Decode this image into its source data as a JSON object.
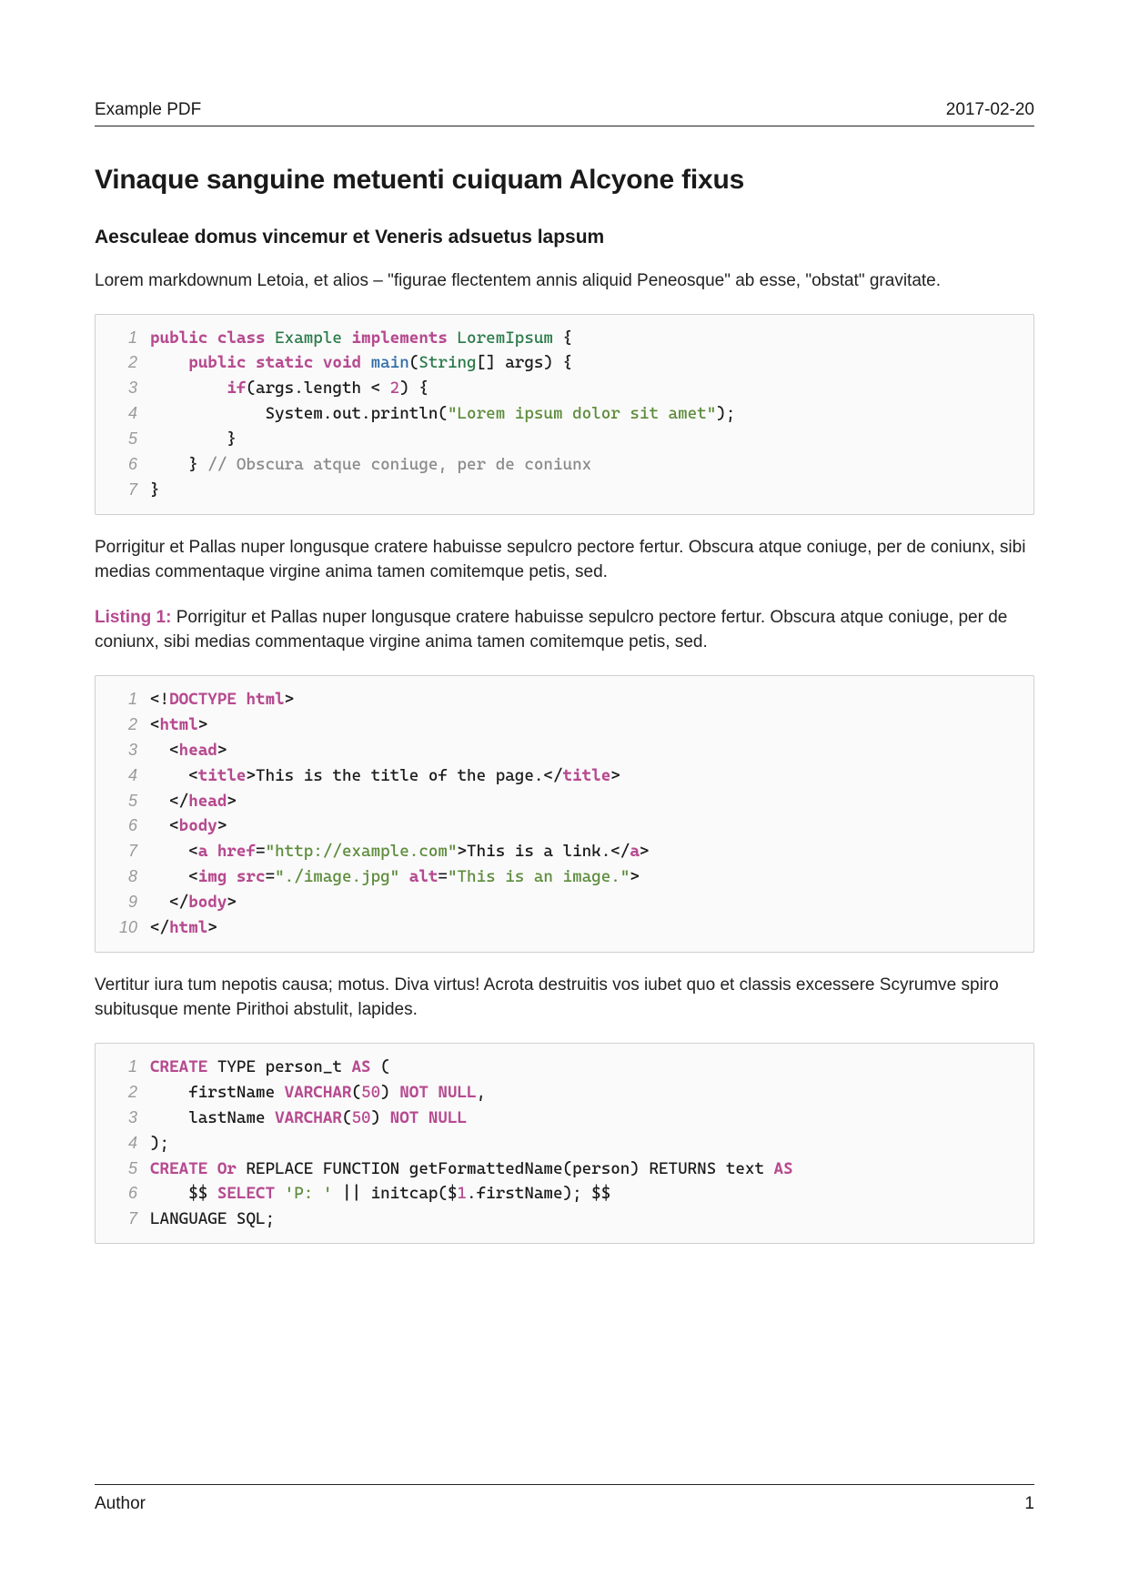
{
  "header": {
    "title": "Example PDF",
    "date": "2017-02-20"
  },
  "h1": "Vinaque sanguine metuenti cuiquam Alcyone fixus",
  "h2": "Aesculeae domus vincemur et Veneris adsuetus lapsum",
  "para1": "Lorem markdownum Letoia, et alios – \"figurae flectentem annis aliquid Peneosque\" ab esse, \"obstat\" gravitate.",
  "code1": {
    "lines": [
      {
        "n": "1",
        "tokens": [
          [
            "kw",
            "public class"
          ],
          [
            "",
            " "
          ],
          [
            "type",
            "Example"
          ],
          [
            "",
            " "
          ],
          [
            "kw",
            "implements"
          ],
          [
            "",
            " "
          ],
          [
            "type",
            "LoremIpsum"
          ],
          [
            "",
            " {"
          ]
        ]
      },
      {
        "n": "2",
        "tokens": [
          [
            "",
            "    "
          ],
          [
            "kw",
            "public static void"
          ],
          [
            "",
            " "
          ],
          [
            "fn",
            "main"
          ],
          [
            "",
            "("
          ],
          [
            "type",
            "String"
          ],
          [
            "",
            "[] "
          ],
          [
            "",
            "args) {"
          ]
        ]
      },
      {
        "n": "3",
        "tokens": [
          [
            "",
            "        "
          ],
          [
            "kw",
            "if"
          ],
          [
            "",
            "(args.length < "
          ],
          [
            "num",
            "2"
          ],
          [
            "",
            ") {"
          ]
        ]
      },
      {
        "n": "4",
        "tokens": [
          [
            "",
            "            System.out.println("
          ],
          [
            "str",
            "\"Lorem ipsum dolor sit amet\""
          ],
          [
            "",
            ");"
          ]
        ]
      },
      {
        "n": "5",
        "tokens": [
          [
            "",
            "        }"
          ]
        ]
      },
      {
        "n": "6",
        "tokens": [
          [
            "",
            "    } "
          ],
          [
            "cm",
            "// Obscura atque coniuge, per de coniunx"
          ]
        ]
      },
      {
        "n": "7",
        "tokens": [
          [
            "",
            "}"
          ]
        ]
      }
    ]
  },
  "para2": "Porrigitur et Pallas nuper longusque cratere habuisse sepulcro pectore fertur. Obscura atque coniuge, per de coniunx, sibi medias commentaque virgine anima tamen comitemque petis, sed.",
  "listing": {
    "label": "Listing 1:",
    "caption": " Porrigitur et Pallas nuper longusque cratere habuisse sepulcro pectore fertur. Obscura atque coniuge, per de coniunx, sibi medias commentaque virgine anima tamen comitemque petis, sed."
  },
  "code2": {
    "lines": [
      {
        "n": "1",
        "tokens": [
          [
            "",
            "<!"
          ],
          [
            "tag",
            "DOCTYPE html"
          ],
          [
            "",
            ">"
          ]
        ]
      },
      {
        "n": "2",
        "tokens": [
          [
            "",
            "<"
          ],
          [
            "tag",
            "html"
          ],
          [
            "",
            ">"
          ]
        ]
      },
      {
        "n": "3",
        "tokens": [
          [
            "",
            "  <"
          ],
          [
            "tag",
            "head"
          ],
          [
            "",
            ">"
          ]
        ]
      },
      {
        "n": "4",
        "tokens": [
          [
            "",
            "    <"
          ],
          [
            "tag",
            "title"
          ],
          [
            "",
            ">This is the title of the page.</"
          ],
          [
            "tag",
            "title"
          ],
          [
            "",
            ">"
          ]
        ]
      },
      {
        "n": "5",
        "tokens": [
          [
            "",
            "  </"
          ],
          [
            "tag",
            "head"
          ],
          [
            "",
            ">"
          ]
        ]
      },
      {
        "n": "6",
        "tokens": [
          [
            "",
            "  <"
          ],
          [
            "tag",
            "body"
          ],
          [
            "",
            ">"
          ]
        ]
      },
      {
        "n": "7",
        "tokens": [
          [
            "",
            "    <"
          ],
          [
            "tag",
            "a href"
          ],
          [
            "",
            "="
          ],
          [
            "attrval",
            "\"http://example.com\""
          ],
          [
            "",
            ">This is a link.</"
          ],
          [
            "tag",
            "a"
          ],
          [
            "",
            ">"
          ]
        ]
      },
      {
        "n": "8",
        "tokens": [
          [
            "",
            "    <"
          ],
          [
            "tag",
            "img src"
          ],
          [
            "",
            "="
          ],
          [
            "attrval",
            "\"./image.jpg\""
          ],
          [
            "",
            " "
          ],
          [
            "tag",
            "alt"
          ],
          [
            "",
            "="
          ],
          [
            "attrval",
            "\"This is an image.\""
          ],
          [
            "",
            ">"
          ]
        ]
      },
      {
        "n": "9",
        "tokens": [
          [
            "",
            "  </"
          ],
          [
            "tag",
            "body"
          ],
          [
            "",
            ">"
          ]
        ]
      },
      {
        "n": "10",
        "tokens": [
          [
            "",
            "</"
          ],
          [
            "tag",
            "html"
          ],
          [
            "",
            ">"
          ]
        ]
      }
    ]
  },
  "para3": "Vertitur iura tum nepotis causa; motus. Diva virtus! Acrota destruitis vos iubet quo et classis excessere Scyrumve spiro subitusque mente Pirithoi abstulit, lapides.",
  "code3": {
    "lines": [
      {
        "n": "1",
        "tokens": [
          [
            "kw",
            "CREATE"
          ],
          [
            "",
            " TYPE person_t "
          ],
          [
            "kw",
            "AS"
          ],
          [
            "",
            " ("
          ]
        ]
      },
      {
        "n": "2",
        "tokens": [
          [
            "",
            "    firstName "
          ],
          [
            "kw",
            "VARCHAR"
          ],
          [
            "",
            "("
          ],
          [
            "num",
            "50"
          ],
          [
            "",
            ") "
          ],
          [
            "kw",
            "NOT NULL"
          ],
          [
            "",
            ","
          ]
        ]
      },
      {
        "n": "3",
        "tokens": [
          [
            "",
            "    lastName "
          ],
          [
            "kw",
            "VARCHAR"
          ],
          [
            "",
            "("
          ],
          [
            "num",
            "50"
          ],
          [
            "",
            ") "
          ],
          [
            "kw",
            "NOT NULL"
          ]
        ]
      },
      {
        "n": "4",
        "tokens": [
          [
            "",
            ");"
          ]
        ]
      },
      {
        "n": "5",
        "tokens": [
          [
            "kw",
            "CREATE Or"
          ],
          [
            "",
            " REPLACE FUNCTION getFormattedName(person) RETURNS text "
          ],
          [
            "kw",
            "AS"
          ]
        ]
      },
      {
        "n": "6",
        "tokens": [
          [
            "",
            "    $$ "
          ],
          [
            "kw",
            "SELECT"
          ],
          [
            "",
            " "
          ],
          [
            "str",
            "'P: '"
          ],
          [
            "",
            " || initcap($"
          ],
          [
            "num",
            "1"
          ],
          [
            "",
            ".firstName); $$"
          ]
        ]
      },
      {
        "n": "7",
        "tokens": [
          [
            "",
            "LANGUAGE SQL;"
          ]
        ]
      }
    ]
  },
  "footer": {
    "author": "Author",
    "page": "1"
  }
}
